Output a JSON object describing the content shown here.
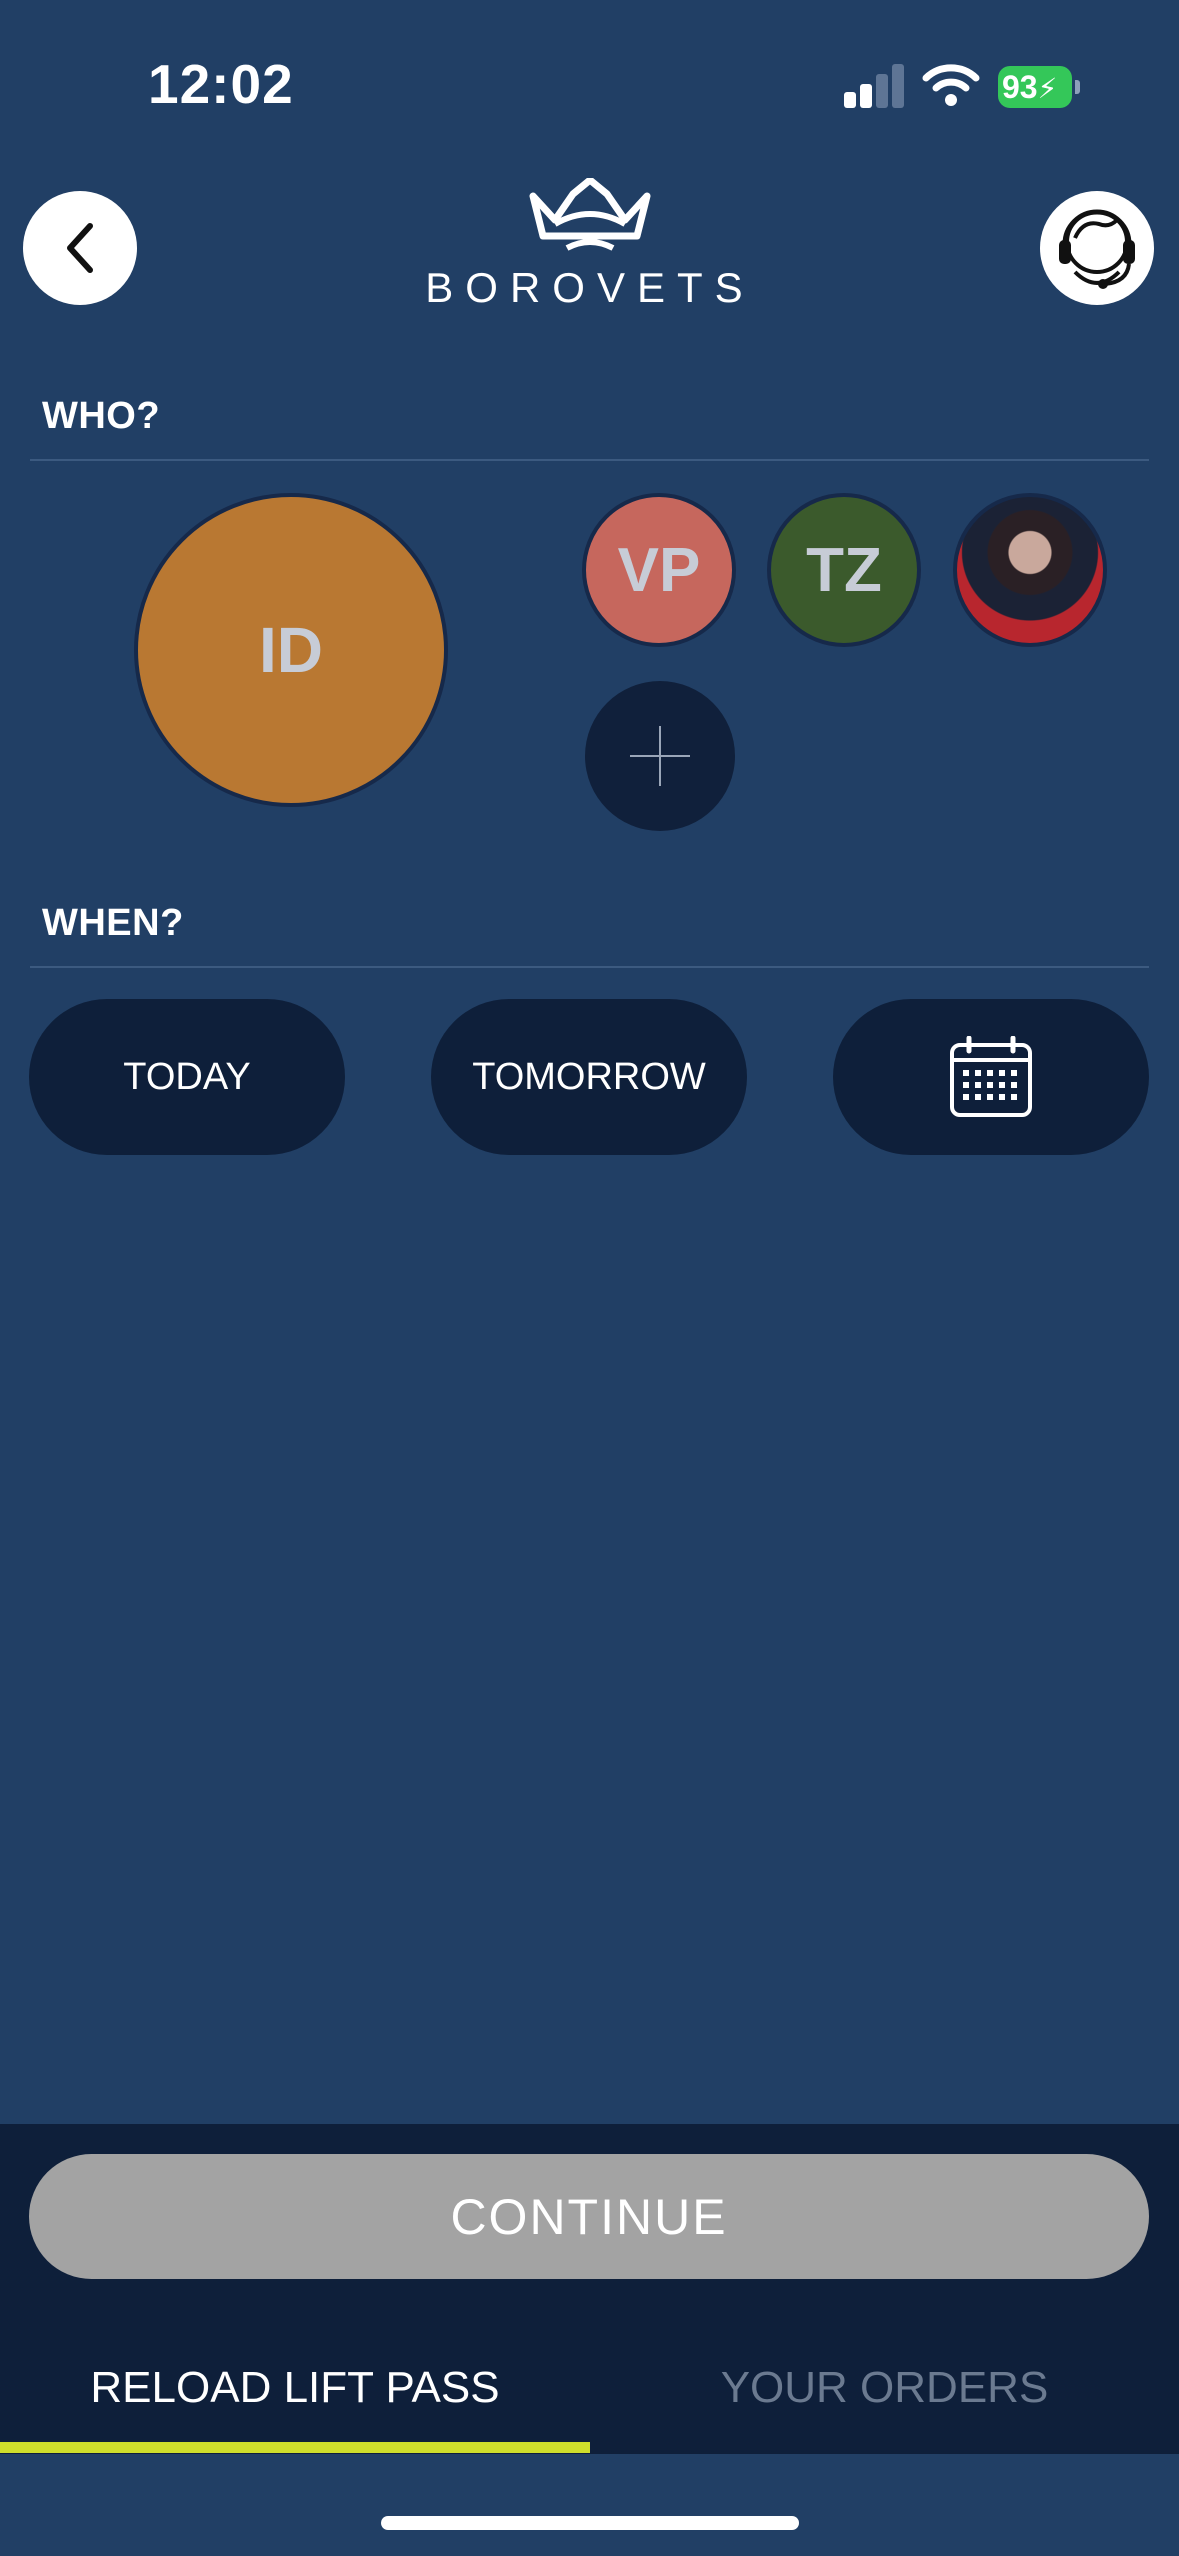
{
  "status_bar": {
    "time": "12:02",
    "battery_level": "93",
    "battery_charging": true,
    "signal_bars_active": 2,
    "signal_bars_total": 4
  },
  "header": {
    "logo_text": "BOROVETS",
    "back_icon": "chevron-left-icon",
    "support_icon": "headset-support-icon"
  },
  "who": {
    "title": "WHO?",
    "main_person": {
      "initials": "ID",
      "color": "#b97832"
    },
    "people": [
      {
        "initials": "VP",
        "color": "#c6675d"
      },
      {
        "initials": "TZ",
        "color": "#3b5a2c"
      },
      {
        "initials": "",
        "type": "photo"
      }
    ],
    "add_icon": "plus-icon"
  },
  "when": {
    "title": "WHEN?",
    "options": [
      {
        "label": "TODAY"
      },
      {
        "label": "TOMORROW"
      },
      {
        "label": "",
        "icon": "calendar-icon"
      }
    ]
  },
  "actions": {
    "continue_label": "CONTINUE"
  },
  "tabs": [
    {
      "label": "RELOAD LIFT PASS",
      "active": true
    },
    {
      "label": "YOUR ORDERS",
      "active": false
    }
  ],
  "colors": {
    "background": "#213f65",
    "dark": "#0e1f3a",
    "accent": "#cfdf2c",
    "continue_disabled": "#a3a3a3"
  }
}
